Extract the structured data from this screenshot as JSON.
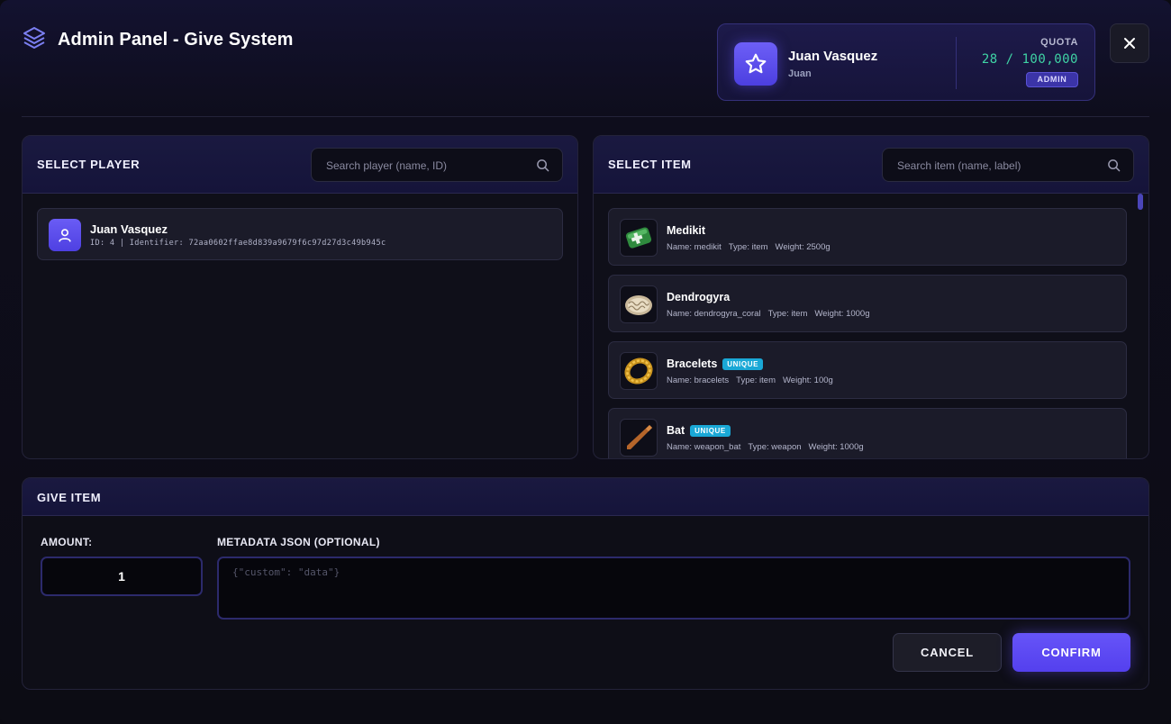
{
  "header": {
    "title": "Admin Panel - Give System",
    "user_name": "Juan Vasquez",
    "user_sub": "Juan",
    "quota_label": "QUOTA",
    "quota_value": "28 / 100,000",
    "role_badge": "ADMIN"
  },
  "select_player": {
    "title": "SELECT PLAYER",
    "search_placeholder": "Search player (name, ID)",
    "players": [
      {
        "name": "Juan Vasquez",
        "details": "ID: 4 | Identifier: 72aa0602ffae8d839a9679f6c97d27d3c49b945c"
      }
    ]
  },
  "select_item": {
    "title": "SELECT ITEM",
    "search_placeholder": "Search item (name, label)",
    "items": [
      {
        "label": "Medikit",
        "badge": "",
        "name": "Name: medikit",
        "type": "Type: item",
        "weight": "Weight: 2500g",
        "icon": "medikit-icon"
      },
      {
        "label": "Dendrogyra",
        "badge": "",
        "name": "Name: dendrogyra_coral",
        "type": "Type: item",
        "weight": "Weight: 1000g",
        "icon": "coral-icon"
      },
      {
        "label": "Bracelets",
        "badge": "UNIQUE",
        "name": "Name: bracelets",
        "type": "Type: item",
        "weight": "Weight: 100g",
        "icon": "bracelet-icon"
      },
      {
        "label": "Bat",
        "badge": "UNIQUE",
        "name": "Name: weapon_bat",
        "type": "Type: weapon",
        "weight": "Weight: 1000g",
        "icon": "bat-icon"
      }
    ]
  },
  "give_item": {
    "title": "GIVE ITEM",
    "amount_label": "AMOUNT:",
    "amount_value": "1",
    "metadata_label": "METADATA JSON (OPTIONAL)",
    "metadata_placeholder": "{\"custom\": \"data\"}",
    "cancel_label": "CANCEL",
    "confirm_label": "CONFIRM"
  },
  "colors": {
    "accent": "#5a48f2",
    "quota": "#3fd4a5",
    "unique_badge": "#1aa8d6"
  }
}
